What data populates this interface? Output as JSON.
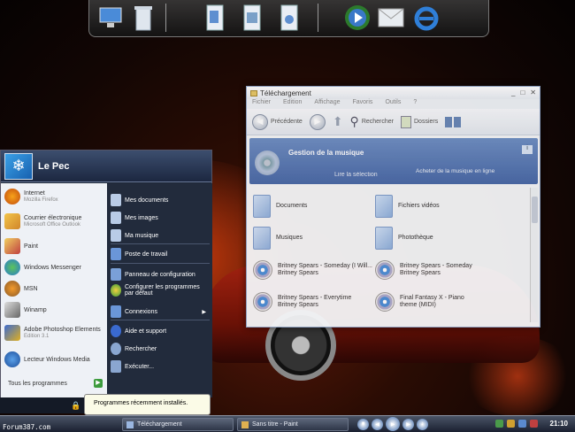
{
  "dock": {
    "icons": [
      "computer-icon",
      "recycle-bin-icon",
      "documents-icon",
      "pictures-icon",
      "music-icon",
      "media-player-icon",
      "mail-icon",
      "internet-explorer-icon"
    ]
  },
  "window": {
    "title": "Téléchargement",
    "menu": [
      "Fichier",
      "Edition",
      "Affichage",
      "Favoris",
      "Outils",
      "?"
    ],
    "toolbar": {
      "back_label": "Précédente",
      "search_label": "Rechercher",
      "folders_label": "Dossiers"
    },
    "banner": {
      "title": "Gestion de la musique",
      "subtitle": "Lire la sélection",
      "right_text": "Acheter de la musique en ligne"
    },
    "files": [
      {
        "type": "folder",
        "line1": "Documents",
        "line2": ""
      },
      {
        "type": "folder",
        "line1": "Fichiers vidéos",
        "line2": ""
      },
      {
        "type": "folder",
        "line1": "Musiques",
        "line2": ""
      },
      {
        "type": "folder",
        "line1": "Photothèque",
        "line2": ""
      },
      {
        "type": "music",
        "line1": "Britney Spears - Someday (I Will...",
        "line2": "Britney Spears"
      },
      {
        "type": "music",
        "line1": "Britney Spears - Someday",
        "line2": "Britney Spears"
      },
      {
        "type": "music",
        "line1": "Britney Spears - Everytime",
        "line2": "Britney Spears"
      },
      {
        "type": "music",
        "line1": "Final Fantasy X - Piano",
        "line2": "theme (MIDI)"
      }
    ]
  },
  "start_menu": {
    "user_name": "Le Pec",
    "left_items": [
      {
        "label": "Internet",
        "sub": "Mozilla Firefox"
      },
      {
        "label": "Courrier électronique",
        "sub": "Microsoft Office Outlook"
      },
      {
        "label": "Paint",
        "sub": ""
      },
      {
        "label": "Windows Messenger",
        "sub": ""
      },
      {
        "label": "MSN",
        "sub": ""
      },
      {
        "label": "Winamp",
        "sub": ""
      },
      {
        "label": "Adobe Photoshop Elements",
        "sub": "Edition 3.1"
      },
      {
        "label": "Lecteur Windows Media",
        "sub": ""
      }
    ],
    "all_programs": "Tous les programmes",
    "right_items": [
      "Mes documents",
      "Mes images",
      "Ma musique",
      "Poste de travail",
      "Panneau de configuration",
      "Configurer les programmes par défaut",
      "Connexions",
      "Aide et support",
      "Rechercher",
      "Exécuter..."
    ]
  },
  "tooltip": "Programmes récemment installés.",
  "taskbar": {
    "tasks": [
      "Téléchargement",
      "Sans titre - Paint"
    ],
    "clock": "21:10"
  },
  "watermark": "Forum387.com"
}
